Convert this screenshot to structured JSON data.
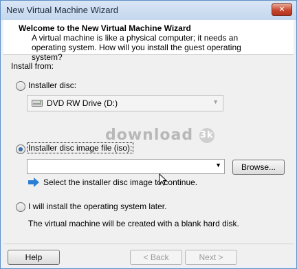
{
  "window": {
    "title": "New Virtual Machine Wizard",
    "close_glyph": "✕"
  },
  "header": {
    "title": "Welcome to the New Virtual Machine Wizard",
    "description": "A virtual machine is like a physical computer; it needs an operating system. How will you install the guest operating system?"
  },
  "install_from_label": "Install from:",
  "options": {
    "installer_disc": {
      "label": "Installer disc:",
      "selected": false
    },
    "disc_drive": {
      "value": "DVD RW Drive (D:)",
      "icon": "dvd-drive-icon"
    },
    "iso": {
      "label": "Installer disc image file (iso):",
      "selected": true
    },
    "iso_path": {
      "value": ""
    },
    "browse_label": "Browse...",
    "hint": "Select the installer disc image to continue.",
    "later": {
      "label": "I will install the operating system later.",
      "selected": false
    },
    "later_note": "The virtual machine will be created with a blank hard disk."
  },
  "watermark": {
    "text": "download",
    "logo": "3k"
  },
  "footer": {
    "help_label": "Help",
    "back_label": "< Back",
    "next_label": "Next >"
  },
  "colors": {
    "accent": "#1f4f8a",
    "hint_arrow": "#2a7fd4",
    "close": "#c7472d"
  }
}
